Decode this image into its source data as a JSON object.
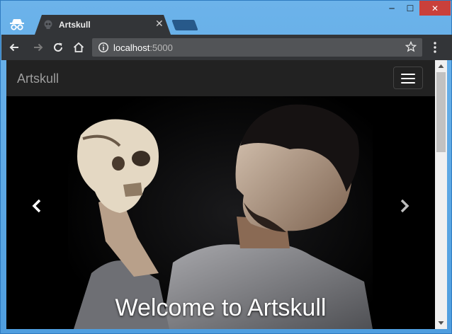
{
  "browser": {
    "window_controls": {
      "minimize": "─",
      "maximize": "☐",
      "close": "✕"
    },
    "tab": {
      "title": "Artskull",
      "close": "✕"
    },
    "address": {
      "host": "localhost",
      "port": ":5000"
    }
  },
  "site": {
    "brand": "Artskull",
    "carousel": {
      "caption": "Welcome to Artskull"
    }
  }
}
